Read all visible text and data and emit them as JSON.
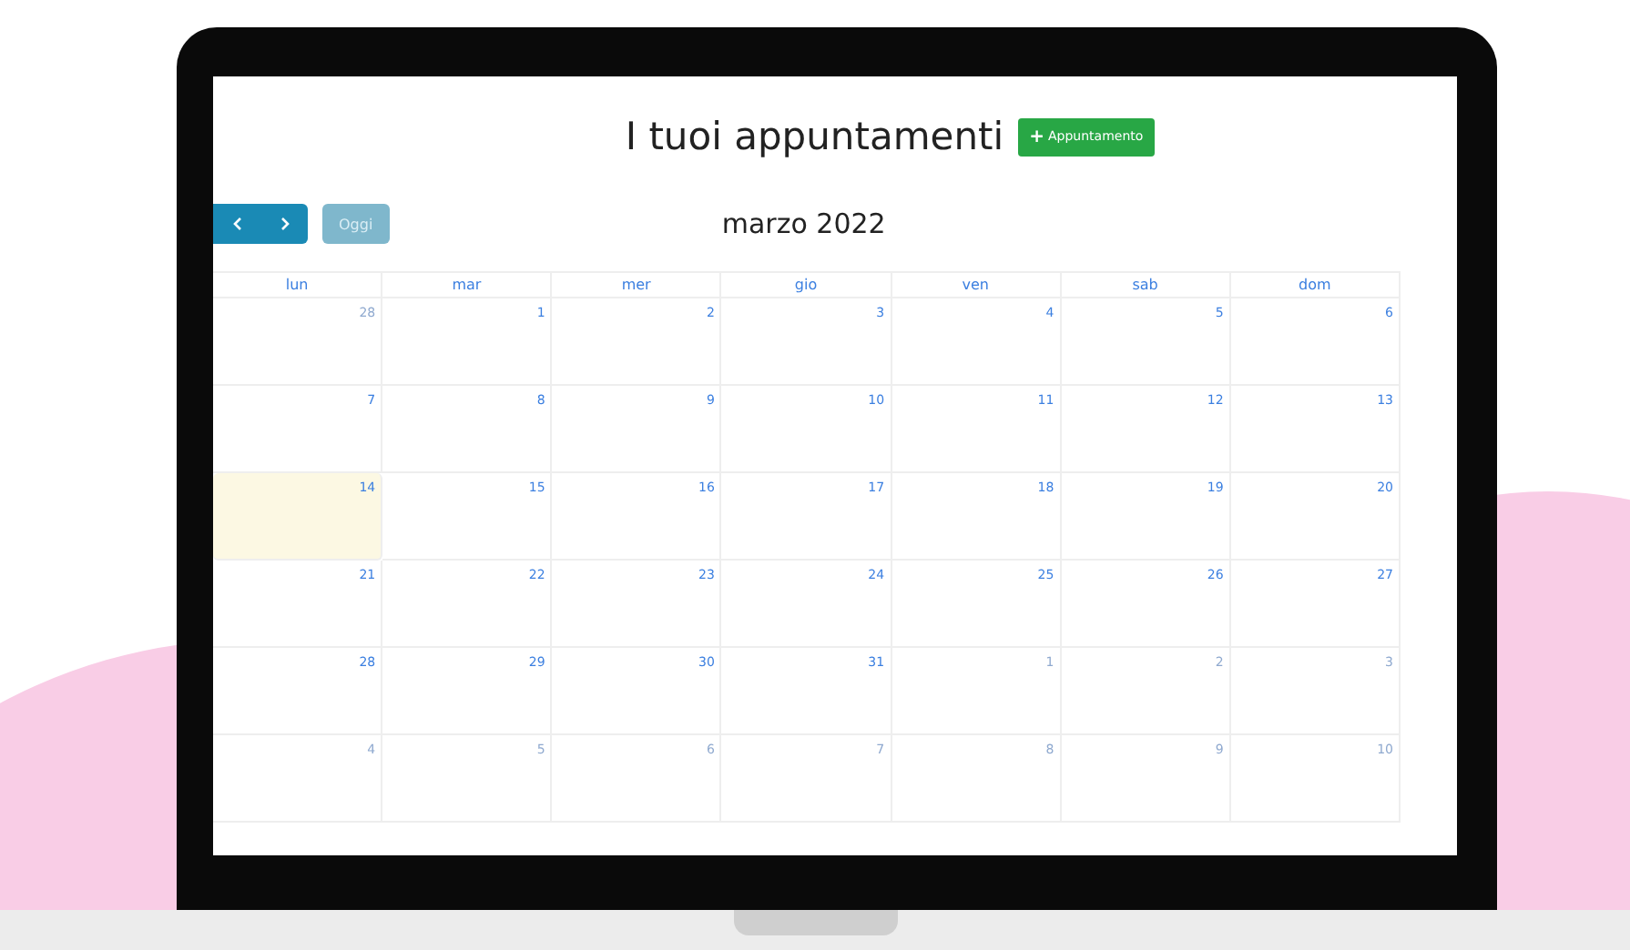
{
  "title": "I tuoi appuntamenti",
  "add_button": {
    "icon": "+",
    "label": "Appuntamento"
  },
  "toolbar": {
    "today_button": {
      "label": "Oggi",
      "disabled": true
    },
    "month": "marzo 2022"
  },
  "weekdays": [
    "lun",
    "mar",
    "mer",
    "gio",
    "ven",
    "sab",
    "dom"
  ],
  "weeks": [
    [
      {
        "day": "28",
        "other_month": true,
        "today": false
      },
      {
        "day": "1",
        "other_month": false,
        "today": false
      },
      {
        "day": "2",
        "other_month": false,
        "today": false
      },
      {
        "day": "3",
        "other_month": false,
        "today": false
      },
      {
        "day": "4",
        "other_month": false,
        "today": false
      },
      {
        "day": "5",
        "other_month": false,
        "today": false
      },
      {
        "day": "6",
        "other_month": false,
        "today": false
      }
    ],
    [
      {
        "day": "7",
        "other_month": false,
        "today": false
      },
      {
        "day": "8",
        "other_month": false,
        "today": false
      },
      {
        "day": "9",
        "other_month": false,
        "today": false
      },
      {
        "day": "10",
        "other_month": false,
        "today": false
      },
      {
        "day": "11",
        "other_month": false,
        "today": false
      },
      {
        "day": "12",
        "other_month": false,
        "today": false
      },
      {
        "day": "13",
        "other_month": false,
        "today": false
      }
    ],
    [
      {
        "day": "14",
        "other_month": false,
        "today": true
      },
      {
        "day": "15",
        "other_month": false,
        "today": false
      },
      {
        "day": "16",
        "other_month": false,
        "today": false
      },
      {
        "day": "17",
        "other_month": false,
        "today": false
      },
      {
        "day": "18",
        "other_month": false,
        "today": false
      },
      {
        "day": "19",
        "other_month": false,
        "today": false
      },
      {
        "day": "20",
        "other_month": false,
        "today": false
      }
    ],
    [
      {
        "day": "21",
        "other_month": false,
        "today": false
      },
      {
        "day": "22",
        "other_month": false,
        "today": false
      },
      {
        "day": "23",
        "other_month": false,
        "today": false
      },
      {
        "day": "24",
        "other_month": false,
        "today": false
      },
      {
        "day": "25",
        "other_month": false,
        "today": false
      },
      {
        "day": "26",
        "other_month": false,
        "today": false
      },
      {
        "day": "27",
        "other_month": false,
        "today": false
      }
    ],
    [
      {
        "day": "28",
        "other_month": false,
        "today": false
      },
      {
        "day": "29",
        "other_month": false,
        "today": false
      },
      {
        "day": "30",
        "other_month": false,
        "today": false
      },
      {
        "day": "31",
        "other_month": false,
        "today": false
      },
      {
        "day": "1",
        "other_month": true,
        "today": false
      },
      {
        "day": "2",
        "other_month": true,
        "today": false
      },
      {
        "day": "3",
        "other_month": true,
        "today": false
      }
    ],
    [
      {
        "day": "4",
        "other_month": true,
        "today": false
      },
      {
        "day": "5",
        "other_month": true,
        "today": false
      },
      {
        "day": "6",
        "other_month": true,
        "today": false
      },
      {
        "day": "7",
        "other_month": true,
        "today": false
      },
      {
        "day": "8",
        "other_month": true,
        "today": false
      },
      {
        "day": "9",
        "other_month": true,
        "today": false
      },
      {
        "day": "10",
        "other_month": true,
        "today": false
      }
    ]
  ]
}
